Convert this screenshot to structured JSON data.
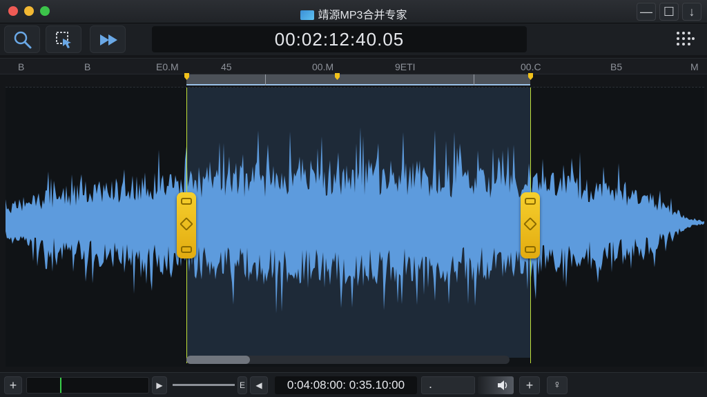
{
  "window": {
    "title": "靖源MP3合并专家",
    "minimize_label": "—",
    "maximize_label": "☐",
    "down_label": "↓"
  },
  "toolbar": {
    "timecode": "00:02:12:40.05",
    "icons": [
      "search-icon",
      "selection-icon",
      "fast-forward-icon",
      "grid-icon"
    ]
  },
  "ruler": {
    "labels": [
      "B",
      "B",
      "E0.M",
      "45",
      "00.M",
      "9ETI",
      "00.C",
      "B5",
      "M"
    ]
  },
  "bottom_bar": {
    "add_label": "+",
    "play_label": "▶",
    "e_label": "E",
    "prev_label": "◀",
    "time_display": "0:04:08:00: 0:35.10:00",
    "field_value": ".",
    "plus_label": "+",
    "pin_label": "♀"
  },
  "colors": {
    "waveform": "#5d9bdd",
    "selection_edge": "#c2e23a",
    "handle": "#f2c21b",
    "background": "#101316"
  }
}
